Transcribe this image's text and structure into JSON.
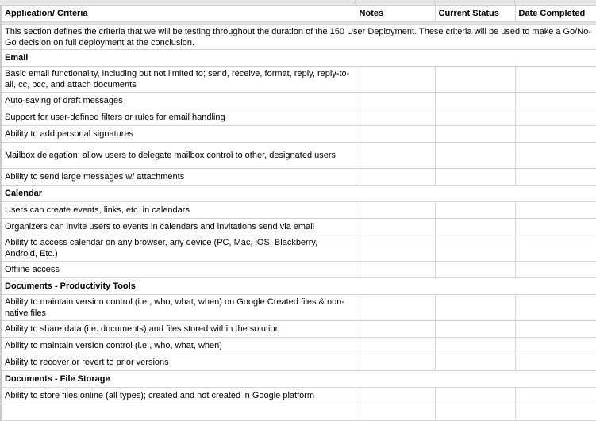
{
  "header": {
    "columns": [
      "Application/ Criteria",
      "Notes",
      "Current Status",
      "Date Completed"
    ]
  },
  "intro": "This section defines the criteria that we will be testing throughout the duration of the 150 User Deployment. These criteria will be used to make a Go/No-Go decision on full deployment at the conclusion.",
  "sections": [
    {
      "title": "Email",
      "rows": [
        {
          "criteria": "Basic email functionality, including but not limited to; send, receive, format, reply, reply-to-all, cc, bcc, and attach documents",
          "notes": "",
          "status": "",
          "date": ""
        },
        {
          "criteria": "Auto-saving of draft messages",
          "notes": "",
          "status": "",
          "date": ""
        },
        {
          "criteria": "Support for user-defined filters or rules for email handling",
          "notes": "",
          "status": "",
          "date": ""
        },
        {
          "criteria": "Ability to add personal signatures",
          "notes": "",
          "status": "",
          "date": ""
        },
        {
          "criteria": "Mailbox delegation; allow users to delegate mailbox control to other, designated users",
          "notes": "",
          "status": "",
          "date": ""
        },
        {
          "criteria": "Ability to send large messages w/ attachments",
          "notes": "",
          "status": "",
          "date": ""
        }
      ]
    },
    {
      "title": "Calendar",
      "rows": [
        {
          "criteria": "Users can create events, links, etc. in calendars",
          "notes": "",
          "status": "",
          "date": ""
        },
        {
          "criteria": "Organizers can invite users to events in calendars and invitations send via email",
          "notes": "",
          "status": "",
          "date": ""
        },
        {
          "criteria": "Ability to access calendar on any browser, any device (PC, Mac, iOS, Blackberry, Android, Etc.)",
          "notes": "",
          "status": "",
          "date": ""
        },
        {
          "criteria": "Offline access",
          "notes": "",
          "status": "",
          "date": ""
        }
      ]
    },
    {
      "title": "Documents - Productivity Tools",
      "rows": [
        {
          "criteria": "Ability to maintain version control (i.e., who, what, when) on Google Created files & non-native files",
          "notes": "",
          "status": "",
          "date": ""
        },
        {
          "criteria": "Ability to share data (i.e. documents) and files stored within the solution",
          "notes": "",
          "status": "",
          "date": ""
        },
        {
          "criteria": "Ability to maintain version control (i.e., who, what, when)",
          "notes": "",
          "status": "",
          "date": ""
        },
        {
          "criteria": "Ability to recover or revert to prior versions",
          "notes": "",
          "status": "",
          "date": ""
        }
      ]
    },
    {
      "title": "Documents - File Storage",
      "rows": [
        {
          "criteria": "Ability to store files online (all types); created and not created in Google platform",
          "notes": "",
          "status": "",
          "date": ""
        },
        {
          "criteria": "",
          "notes": "",
          "status": "",
          "date": ""
        }
      ]
    }
  ]
}
